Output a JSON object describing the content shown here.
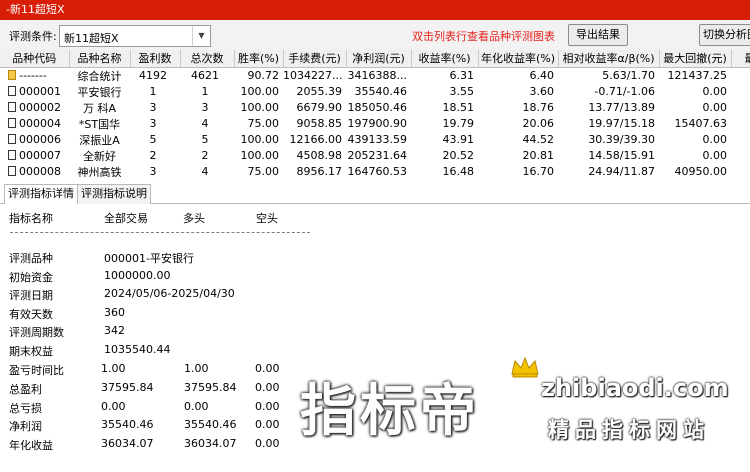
{
  "window": {
    "title": "-新11超短X"
  },
  "toolbar": {
    "condition_label": "评测条件:",
    "condition_value": "新11超短X",
    "hint": "双击列表行查看品种评测图表",
    "export_label": "导出结果",
    "switch_label": "切换分析图"
  },
  "table": {
    "columns": [
      "品种代码",
      "品种名称",
      "盈利数",
      "总次数",
      "胜率(%)",
      "手续费(元)",
      "净利润(元)",
      "收益率(%)",
      "年化收益率(%)",
      "相对收益率α/β(%)",
      "最大回撤(元)",
      "最大"
    ],
    "rows": [
      {
        "code": "-------",
        "name": "综合统计",
        "win": "4192",
        "total": "4621",
        "rate": "90.72",
        "fee": "1034227...",
        "profit": "3416388...",
        "ret": "6.31",
        "annual": "6.40",
        "rel": "5.63/1.70",
        "dd": "121437.25",
        "extra": ""
      },
      {
        "code": "000001",
        "name": "平安银行",
        "win": "1",
        "total": "1",
        "rate": "100.00",
        "fee": "2055.39",
        "profit": "35540.46",
        "ret": "3.55",
        "annual": "3.60",
        "rel": "-0.71/-1.06",
        "dd": "0.00",
        "extra": ""
      },
      {
        "code": "000002",
        "name": "万 科A",
        "win": "3",
        "total": "3",
        "rate": "100.00",
        "fee": "6679.90",
        "profit": "185050.46",
        "ret": "18.51",
        "annual": "18.76",
        "rel": "13.77/13.89",
        "dd": "0.00",
        "extra": ""
      },
      {
        "code": "000004",
        "name": "*ST国华",
        "win": "3",
        "total": "4",
        "rate": "75.00",
        "fee": "9058.85",
        "profit": "197900.90",
        "ret": "19.79",
        "annual": "20.06",
        "rel": "19.97/15.18",
        "dd": "15407.63",
        "extra": ""
      },
      {
        "code": "000006",
        "name": "深振业A",
        "win": "5",
        "total": "5",
        "rate": "100.00",
        "fee": "12166.00",
        "profit": "439133.59",
        "ret": "43.91",
        "annual": "44.52",
        "rel": "30.39/39.30",
        "dd": "0.00",
        "extra": ""
      },
      {
        "code": "000007",
        "name": "全新好",
        "win": "2",
        "total": "2",
        "rate": "100.00",
        "fee": "4508.98",
        "profit": "205231.64",
        "ret": "20.52",
        "annual": "20.81",
        "rel": "14.58/15.91",
        "dd": "0.00",
        "extra": ""
      },
      {
        "code": "000008",
        "name": "神州高铁",
        "win": "3",
        "total": "4",
        "rate": "75.00",
        "fee": "8956.17",
        "profit": "164760.53",
        "ret": "16.48",
        "annual": "16.70",
        "rel": "24.94/11.87",
        "dd": "40950.00",
        "extra": ""
      }
    ]
  },
  "tabs": [
    "评测指标详情",
    "评测指标说明"
  ],
  "detail": {
    "headers": {
      "name": "指标名称",
      "all": "全部交易",
      "long": "多头",
      "short": "空头"
    },
    "info": [
      {
        "label": "评测品种",
        "value": "000001-平安银行"
      },
      {
        "label": "初始资金",
        "value": "1000000.00"
      },
      {
        "label": "评测日期",
        "value": "2024/05/06-2025/04/30"
      },
      {
        "label": "有效天数",
        "value": "360"
      },
      {
        "label": "评测周期数",
        "value": "342"
      },
      {
        "label": "期末权益",
        "value": "1035540.44"
      }
    ],
    "metrics": [
      {
        "label": "盈亏时间比",
        "all": "1.00",
        "long": "1.00",
        "short": "0.00"
      },
      {
        "label": "总盈利",
        "all": "37595.84",
        "long": "37595.84",
        "short": "0.00"
      },
      {
        "label": "总亏损",
        "all": "0.00",
        "long": "0.00",
        "short": "0.00"
      },
      {
        "label": "净利润",
        "all": "35540.46",
        "long": "35540.46",
        "short": "0.00"
      },
      {
        "label": "年化收益",
        "all": "36034.07",
        "long": "36034.07",
        "short": "0.00"
      }
    ]
  },
  "watermark": {
    "brand": "指标帝",
    "url": "zhibiaodi.com",
    "tagline": "精品指标网站"
  }
}
